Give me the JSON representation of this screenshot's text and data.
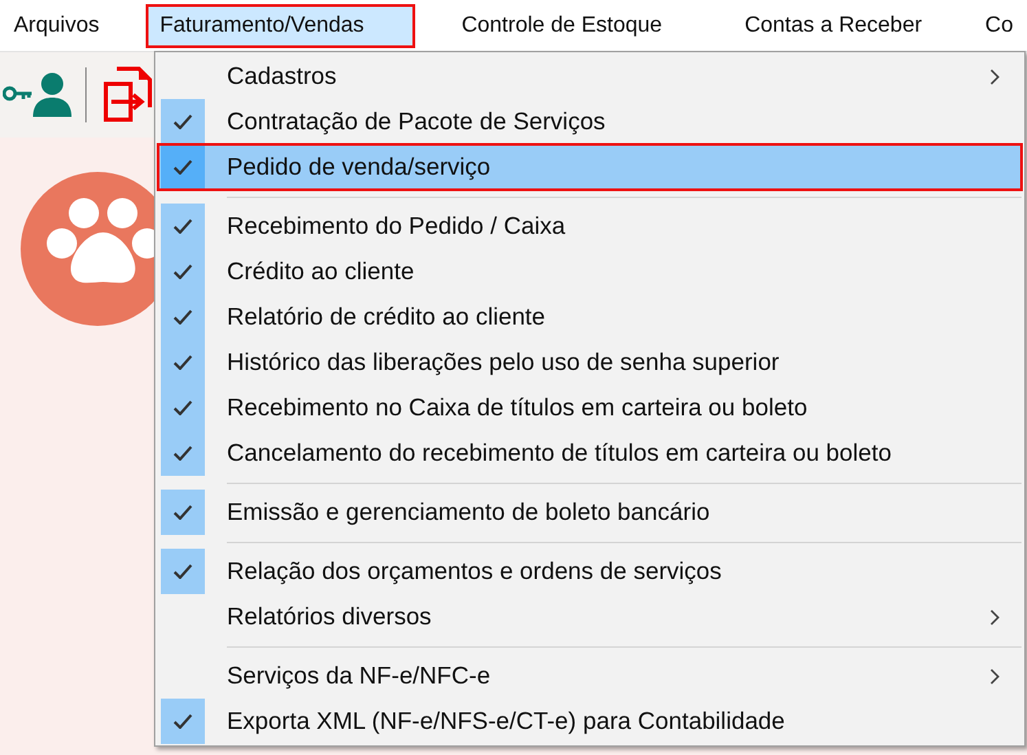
{
  "menu_bar": [
    {
      "label": "Arquivos",
      "selected": false,
      "outlined": false
    },
    {
      "label": "Faturamento/Vendas",
      "selected": true,
      "outlined": true
    },
    {
      "label": "Controle de Estoque",
      "selected": false,
      "outlined": false
    },
    {
      "label": "Contas a Receber",
      "selected": false,
      "outlined": false
    },
    {
      "label": "Co",
      "selected": false,
      "outlined": false
    }
  ],
  "dropdown": [
    {
      "kind": "item",
      "label": "Cadastros",
      "checked": false,
      "submenu": true,
      "selected": false,
      "outlined": false
    },
    {
      "kind": "item",
      "label": "Contratação de Pacote de Serviços",
      "checked": true,
      "submenu": false,
      "selected": false,
      "outlined": false
    },
    {
      "kind": "item",
      "label": "Pedido de venda/serviço",
      "checked": true,
      "submenu": false,
      "selected": true,
      "outlined": true
    },
    {
      "kind": "separator"
    },
    {
      "kind": "item",
      "label": "Recebimento do Pedido / Caixa",
      "checked": true,
      "submenu": false,
      "selected": false,
      "outlined": false
    },
    {
      "kind": "item",
      "label": "Crédito ao cliente",
      "checked": true,
      "submenu": false,
      "selected": false,
      "outlined": false
    },
    {
      "kind": "item",
      "label": "Relatório de crédito ao cliente",
      "checked": true,
      "submenu": false,
      "selected": false,
      "outlined": false
    },
    {
      "kind": "item",
      "label": "Histórico das liberações pelo uso de senha superior",
      "checked": true,
      "submenu": false,
      "selected": false,
      "outlined": false
    },
    {
      "kind": "item",
      "label": "Recebimento no Caixa de títulos em carteira ou boleto",
      "checked": true,
      "submenu": false,
      "selected": false,
      "outlined": false
    },
    {
      "kind": "item",
      "label": "Cancelamento do recebimento de títulos em carteira ou boleto",
      "checked": true,
      "submenu": false,
      "selected": false,
      "outlined": false
    },
    {
      "kind": "separator"
    },
    {
      "kind": "item",
      "label": "Emissão e gerenciamento de boleto bancário",
      "checked": true,
      "submenu": false,
      "selected": false,
      "outlined": false
    },
    {
      "kind": "separator"
    },
    {
      "kind": "item",
      "label": "Relação dos orçamentos e ordens de serviços",
      "checked": true,
      "submenu": false,
      "selected": false,
      "outlined": false
    },
    {
      "kind": "item",
      "label": "Relatórios diversos",
      "checked": false,
      "submenu": true,
      "selected": false,
      "outlined": false
    },
    {
      "kind": "separator"
    },
    {
      "kind": "item",
      "label": "Serviços da NF-e/NFC-e",
      "checked": false,
      "submenu": true,
      "selected": false,
      "outlined": false
    },
    {
      "kind": "item",
      "label": "Exporta XML (NF-e/NFS-e/CT-e) para Contabilidade",
      "checked": true,
      "submenu": false,
      "selected": false,
      "outlined": false
    }
  ]
}
